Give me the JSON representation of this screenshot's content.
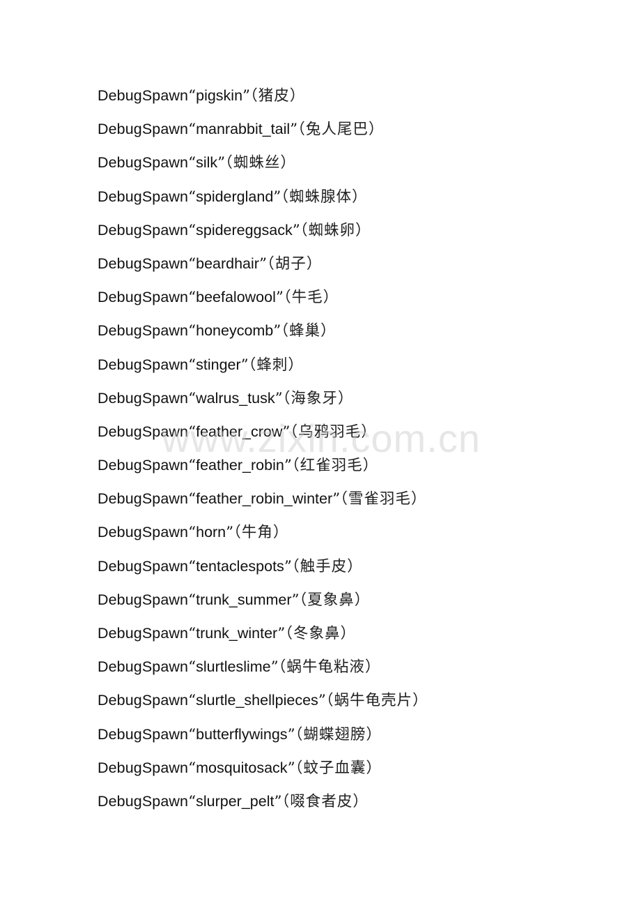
{
  "document": {
    "command": "DebugSpawn",
    "quote_open": "“",
    "quote_close": "”",
    "paren_open": "（",
    "paren_close": "）",
    "watermark": "www.zixin.com.cn",
    "items": [
      {
        "id": "pigskin",
        "name_cn": "猪皮"
      },
      {
        "id": "manrabbit_tail",
        "name_cn": "兔人尾巴"
      },
      {
        "id": "silk",
        "name_cn": "蜘蛛丝"
      },
      {
        "id": "spidergland",
        "name_cn": "蜘蛛腺体"
      },
      {
        "id": "spidereggsack",
        "name_cn": "蜘蛛卵"
      },
      {
        "id": "beardhair",
        "name_cn": "胡子"
      },
      {
        "id": "beefalowool",
        "name_cn": "牛毛"
      },
      {
        "id": "honeycomb",
        "name_cn": "蜂巢"
      },
      {
        "id": "stinger",
        "name_cn": "蜂刺"
      },
      {
        "id": "walrus_tusk",
        "name_cn": "海象牙"
      },
      {
        "id": "feather_crow",
        "name_cn": "乌鸦羽毛"
      },
      {
        "id": "feather_robin",
        "name_cn": "红雀羽毛"
      },
      {
        "id": "feather_robin_winter",
        "name_cn": "雪雀羽毛"
      },
      {
        "id": "horn",
        "name_cn": "牛角"
      },
      {
        "id": "tentaclespots",
        "name_cn": "触手皮"
      },
      {
        "id": "trunk_summer",
        "name_cn": "夏象鼻"
      },
      {
        "id": "trunk_winter",
        "name_cn": "冬象鼻"
      },
      {
        "id": "slurtleslime",
        "name_cn": "蜗牛龟粘液"
      },
      {
        "id": "slurtle_shellpieces",
        "name_cn": "蜗牛龟壳片"
      },
      {
        "id": "butterflywings",
        "name_cn": "蝴蝶翅膀"
      },
      {
        "id": "mosquitosack",
        "name_cn": "蚊子血囊"
      },
      {
        "id": "slurper_pelt",
        "name_cn": "啜食者皮"
      }
    ]
  }
}
